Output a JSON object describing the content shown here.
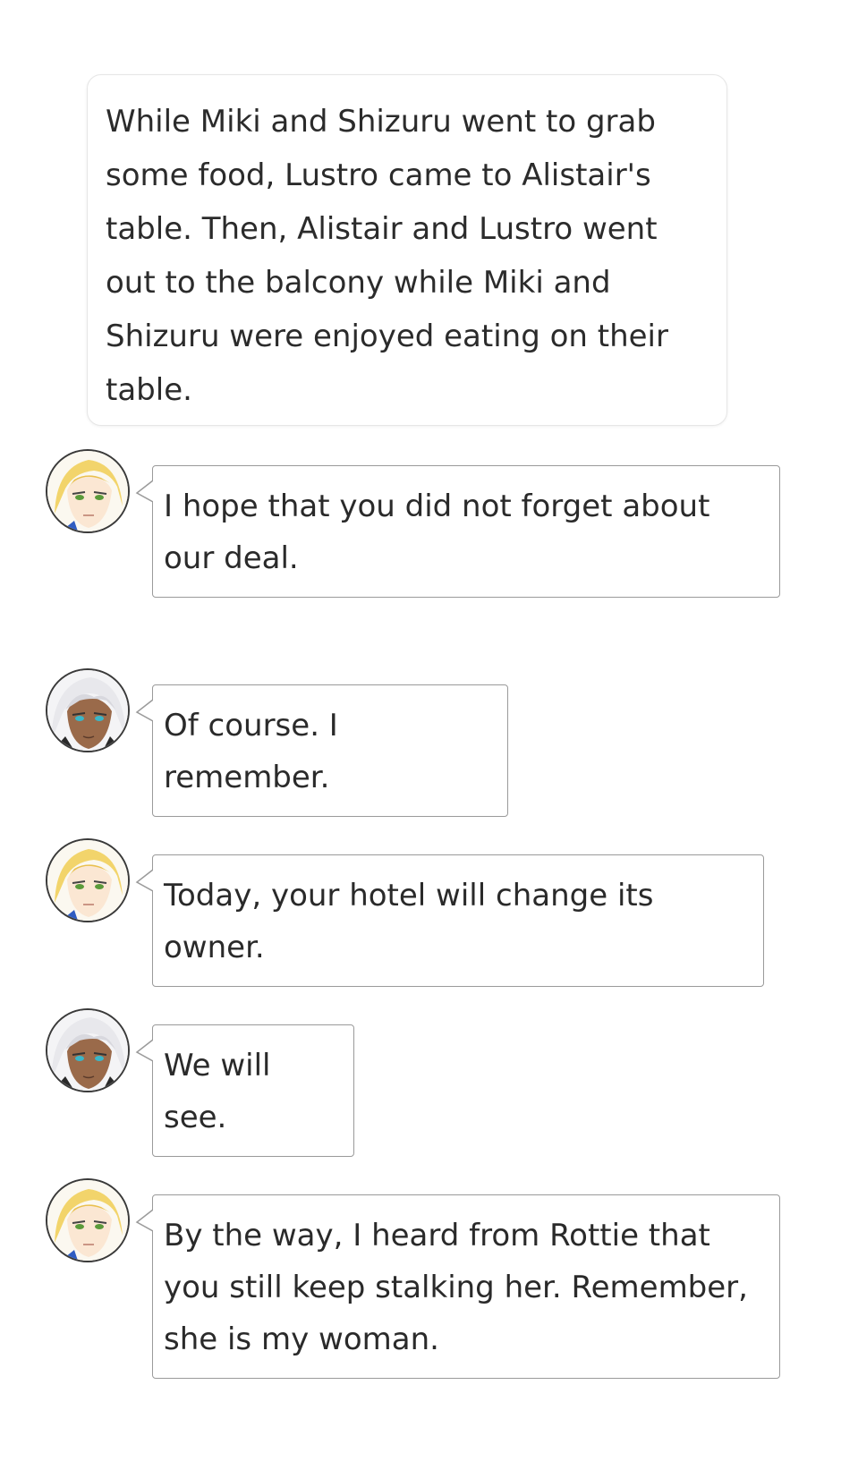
{
  "narration": {
    "text": "While Miki and Shizuru went to grab some food, Lustro came to Alistair's table. Then, Alistair and Lustro went out to the balcony while Miki and Shizuru were enjoyed eating on their table."
  },
  "messages": [
    {
      "speaker_icon": "blonde-character-avatar-icon",
      "text": "I hope that you did not forget about our deal."
    },
    {
      "speaker_icon": "white-haired-character-avatar-icon",
      "text": "Of course. I remember."
    },
    {
      "speaker_icon": "blonde-character-avatar-icon",
      "text": "Today, your hotel will change its owner."
    },
    {
      "speaker_icon": "white-haired-character-avatar-icon",
      "text": "We will see."
    },
    {
      "speaker_icon": "blonde-character-avatar-icon",
      "text": "By the way, I heard from Rottie that you still keep stalking her. Remember, she is my woman."
    }
  ],
  "colors": {
    "blonde_hair": "#f2d46b",
    "white_hair": "#e8e8ec",
    "bubble_border": "#9a9a9a",
    "text": "#2a2a2a"
  }
}
